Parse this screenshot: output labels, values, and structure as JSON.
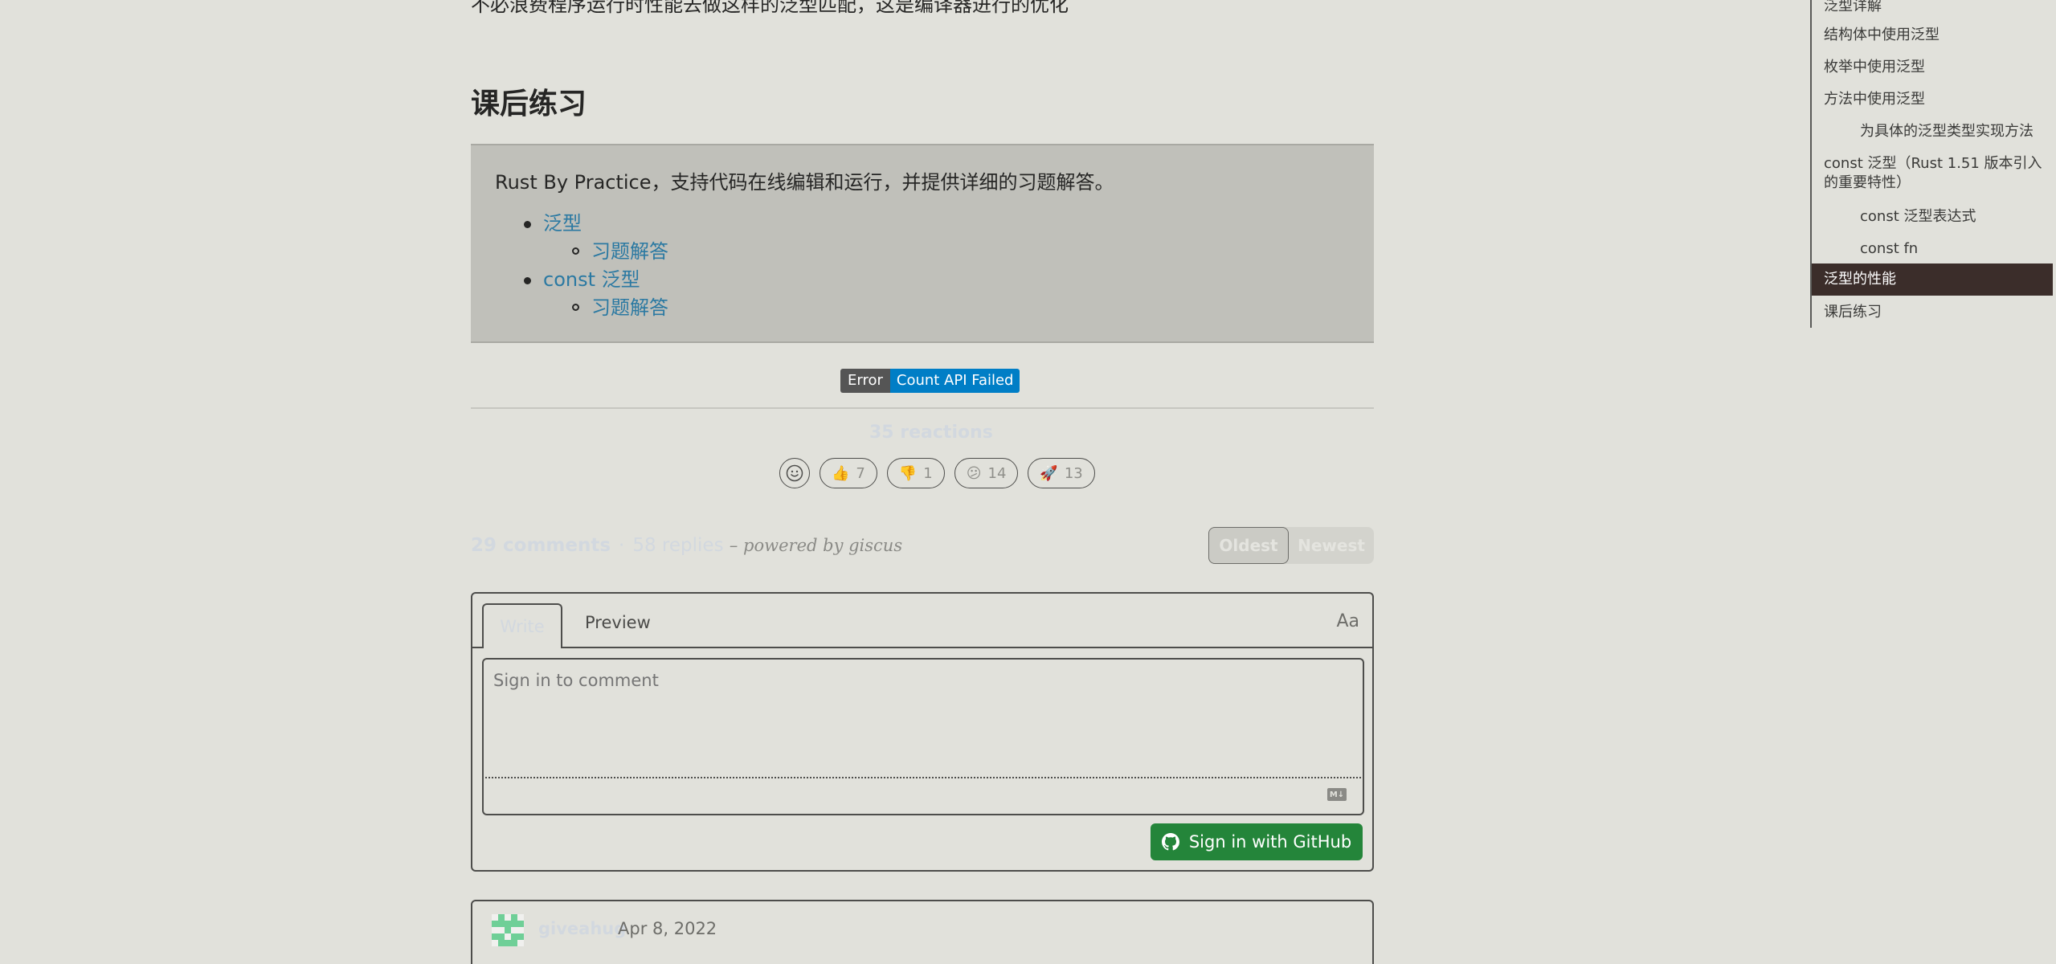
{
  "article": {
    "cut_text": "不必浪费程序运行时性能去做这样的泛型匹配，这是编译器进行的优化",
    "exercise_heading": "课后练习",
    "quote_text": "Rust By Practice，支持代码在线编辑和运行，并提供详细的习题解答。",
    "links": [
      {
        "label": "泛型",
        "sub": "习题解答"
      },
      {
        "label": "const 泛型",
        "sub": "习题解答"
      }
    ]
  },
  "badge": {
    "left": "Error",
    "right": "Count API Failed"
  },
  "reactions": {
    "count_label": "35 reactions",
    "items": [
      {
        "emoji": "👍",
        "count": "7"
      },
      {
        "emoji": "👎",
        "count": "1"
      },
      {
        "emoji": "😕",
        "count": "14"
      },
      {
        "emoji": "🚀",
        "count": "13"
      }
    ]
  },
  "discussion": {
    "comments": "29 comments",
    "replies": "58 replies",
    "powered": "– powered by giscus",
    "sort_oldest": "Oldest",
    "sort_newest": "Newest"
  },
  "editor": {
    "tab_write": "Write",
    "tab_preview": "Preview",
    "aa": "Aa",
    "placeholder": "Sign in to comment",
    "md_badge": "M↓",
    "signin_button": "Sign in with GitHub"
  },
  "comment": {
    "user": "giveahug",
    "date": "Apr 8, 2022"
  },
  "toc": {
    "items": [
      {
        "label": "泛型详解",
        "sub": false
      },
      {
        "label": "结构体中使用泛型",
        "sub": false
      },
      {
        "label": "枚举中使用泛型",
        "sub": false
      },
      {
        "label": "方法中使用泛型",
        "sub": false
      },
      {
        "label": "为具体的泛型类型实现方法",
        "sub": true
      },
      {
        "label": "const 泛型（Rust 1.51 版本引入的重要特性）",
        "sub": false
      },
      {
        "label": "const 泛型表达式",
        "sub": true
      },
      {
        "label": "const fn",
        "sub": true
      },
      {
        "label": "泛型的性能",
        "sub": false,
        "active": true
      },
      {
        "label": "课后练习",
        "sub": false
      }
    ]
  },
  "colors": {
    "accent_link": "#2b79a2",
    "github_green": "#24853a",
    "toc_active": "#3b2d2a",
    "badge_blue": "#007ec6"
  }
}
